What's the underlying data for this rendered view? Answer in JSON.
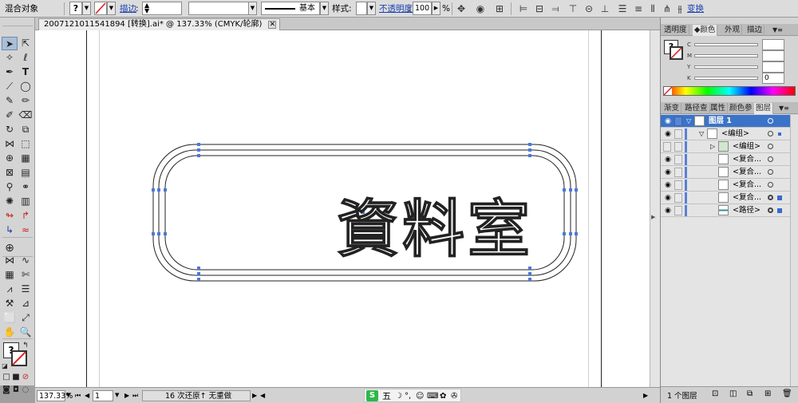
{
  "control_bar": {
    "object_type": "混合对象",
    "fill_label": "?",
    "stroke_link": "描边",
    "stroke_profile": "基本",
    "style_label": "样式:",
    "opacity_link": "不透明度",
    "opacity_value": "100",
    "opacity_unit": "%",
    "transform_link": "变换"
  },
  "document": {
    "tab_title": "20071210115418​94 [转换].ai* @ 137.33% (CMYK/轮廓)",
    "artwork_text": "資料室",
    "zoom": "137.33%",
    "artboard_number": "1",
    "status_text": "16 次还原↑ 无重做"
  },
  "fill_stroke": {
    "fill_label": "?"
  },
  "color_panel": {
    "tabs": [
      "透明度",
      "颜色",
      "外观",
      "描边"
    ],
    "channels": [
      {
        "label": "C",
        "value": ""
      },
      {
        "label": "M",
        "value": ""
      },
      {
        "label": "Y",
        "value": ""
      },
      {
        "label": "K",
        "value": "0"
      }
    ],
    "fill_label": "?"
  },
  "layers_panel": {
    "tabs": [
      "渐变",
      "路径查",
      "属性",
      "颜色参",
      "图层"
    ],
    "layers": [
      {
        "name": "图层 1"
      },
      {
        "name": "<编组>"
      },
      {
        "name": "<编组>"
      },
      {
        "name": "<复合..."
      },
      {
        "name": "<复合..."
      },
      {
        "name": "<复合..."
      },
      {
        "name": "<复合..."
      },
      {
        "name": "<路径>"
      }
    ],
    "footer_count": "1 个图层"
  },
  "taskbar": {
    "ime_label": "五"
  },
  "colors": {
    "selection": "#3b73c8",
    "anchor": "#4a78d8",
    "accent_link": "#1a3fb0"
  }
}
